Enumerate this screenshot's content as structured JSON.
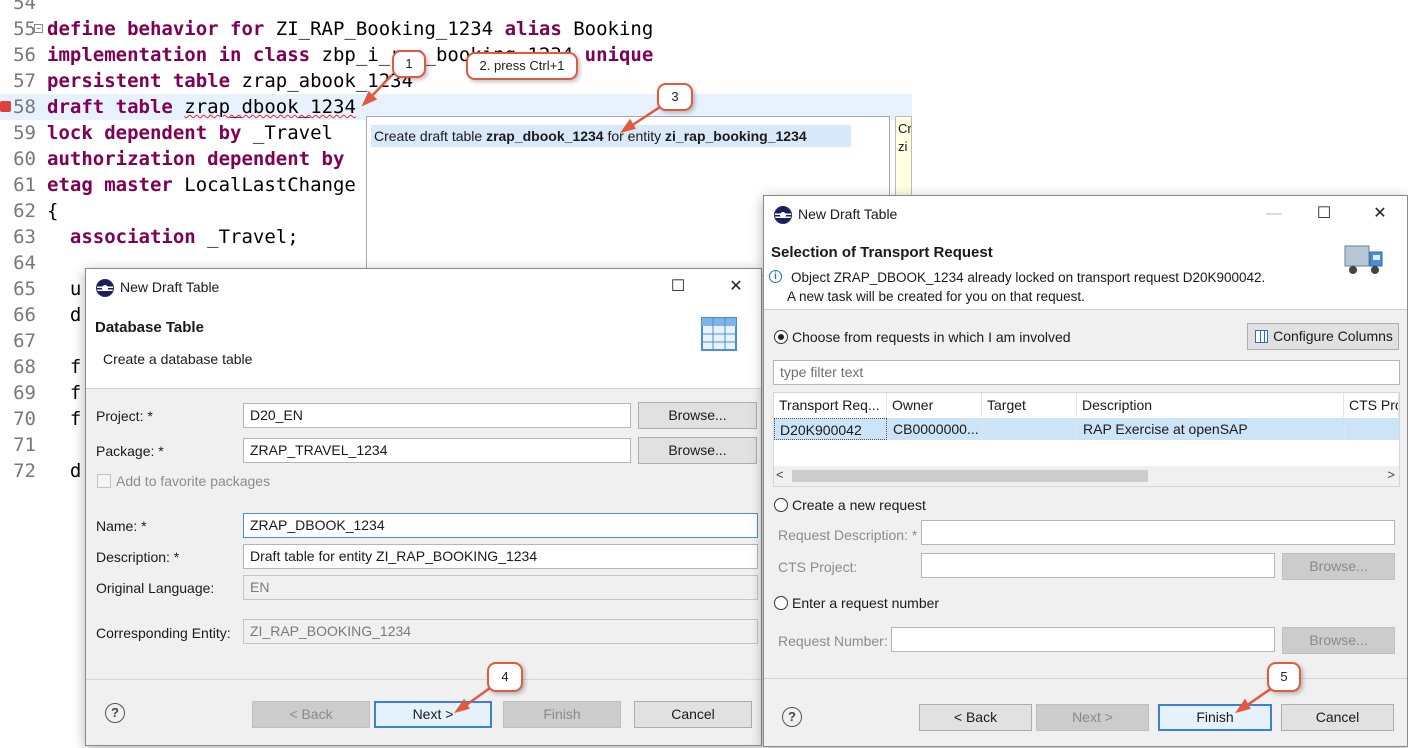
{
  "editor": {
    "lines": [
      {
        "no": "54",
        "code": ""
      },
      {
        "no": "55",
        "code": "define behavior for ZI_RAP_Booking_1234 alias Booking"
      },
      {
        "no": "56",
        "code": "implementation in class zbp_i_rap_booking_1234 unique"
      },
      {
        "no": "57",
        "code": "persistent table zrap_abook_1234"
      },
      {
        "no": "58",
        "code": "draft table zrap_dbook_1234"
      },
      {
        "no": "59",
        "code": "lock dependent by _Travel"
      },
      {
        "no": "60",
        "code": "authorization dependent by"
      },
      {
        "no": "61",
        "code": "etag master LocalLastChange"
      },
      {
        "no": "62",
        "code": "{"
      },
      {
        "no": "63",
        "code": "  association _Travel;"
      },
      {
        "no": "64",
        "code": ""
      },
      {
        "no": "65",
        "code": "  u"
      },
      {
        "no": "66",
        "code": "  d"
      },
      {
        "no": "67",
        "code": ""
      },
      {
        "no": "68",
        "code": "  f"
      },
      {
        "no": "69",
        "code": "  f"
      },
      {
        "no": "70",
        "code": "  f"
      },
      {
        "no": "71",
        "code": ""
      },
      {
        "no": "72",
        "code": "  d"
      }
    ]
  },
  "quickfix": {
    "pre": "Create draft table ",
    "table": "zrap_dbook_1234",
    "mid": " for entity ",
    "entity": "zi_rap_booking_1234",
    "detail": "Cr zi"
  },
  "callouts": {
    "c1": "1",
    "c2": "2. press Ctrl+1",
    "c3": "3",
    "c4": "4",
    "c5": "5"
  },
  "dialog1": {
    "title": "New Draft Table",
    "header_title": "Database Table",
    "header_sub": "Create a database table",
    "project_label": "Project: *",
    "project_value": "D20_EN",
    "package_label": "Package: *",
    "package_value": "ZRAP_TRAVEL_1234",
    "browse": "Browse...",
    "favorite": "Add to favorite packages",
    "name_label": "Name: *",
    "name_value": "ZRAP_DBOOK_1234",
    "desc_label": "Description: *",
    "desc_value": "Draft table for entity ZI_RAP_BOOKING_1234",
    "lang_label": "Original Language:",
    "lang_value": "EN",
    "entity_label": "Corresponding Entity:",
    "entity_value": "ZI_RAP_BOOKING_1234",
    "back": "< Back",
    "next": "Next >",
    "finish": "Finish",
    "cancel": "Cancel"
  },
  "dialog2": {
    "title": "New Draft Table",
    "header_title": "Selection of Transport Request",
    "info_line1": "Object ZRAP_DBOOK_1234 already locked on transport request D20K900042.",
    "info_line2": "A new task will be created for you on that request.",
    "choose_label": "Choose from requests in which I am involved",
    "configure_columns": "Configure Columns",
    "filter_placeholder": "type filter text",
    "columns": [
      "Transport Req...",
      "Owner",
      "Target",
      "Description",
      "CTS Proj"
    ],
    "row": {
      "request": "D20K900042",
      "owner": "CB0000000...",
      "target": "",
      "description": "RAP Exercise at openSAP",
      "cts": ""
    },
    "create_label": "Create a new request",
    "req_desc_label": "Request Description: *",
    "cts_label": "CTS Project:",
    "browse": "Browse...",
    "enter_label": "Enter a request number",
    "req_number_label": "Request Number:",
    "back": "< Back",
    "next": "Next >",
    "finish": "Finish",
    "cancel": "Cancel"
  }
}
